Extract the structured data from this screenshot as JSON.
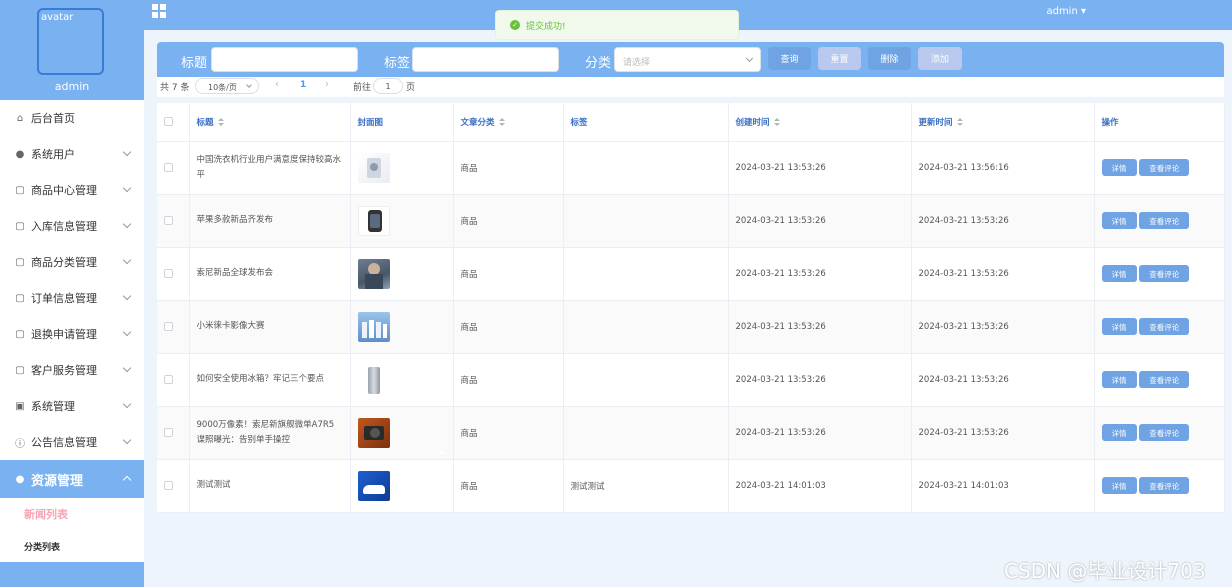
{
  "header": {
    "system_title": "",
    "user_menu": "admin ▾"
  },
  "toast": {
    "message": "提交成功!"
  },
  "sidebar": {
    "avatar_alt": "avatar",
    "username": "admin",
    "items": [
      {
        "label": "后台首页",
        "icon": "home-icon"
      },
      {
        "label": "系统用户",
        "icon": "user-icon"
      },
      {
        "label": "商品中心管理",
        "icon": "folder-icon"
      },
      {
        "label": "入库信息管理",
        "icon": "folder-icon"
      },
      {
        "label": "商品分类管理",
        "icon": "folder-icon"
      },
      {
        "label": "订单信息管理",
        "icon": "folder-icon"
      },
      {
        "label": "退换申请管理",
        "icon": "folder-icon"
      },
      {
        "label": "客户服务管理",
        "icon": "folder-icon"
      },
      {
        "label": "系统管理",
        "icon": "picture-icon"
      },
      {
        "label": "公告信息管理",
        "icon": "info-icon"
      },
      {
        "label": "资源管理",
        "icon": "bulb-icon"
      }
    ],
    "sub_items": [
      {
        "label": "新闻列表"
      },
      {
        "label": "分类列表"
      }
    ]
  },
  "search": {
    "title_label": "标题",
    "tag_label": "标签",
    "category_label": "分类",
    "category_placeholder": "请选择",
    "query_button": "查询",
    "reset_button": "重置",
    "delete_button": "删除",
    "add_button": "添加"
  },
  "pagination": {
    "total": "共 7 条",
    "page_size": "10条/页",
    "current_page": "1",
    "goto_prefix": "前往",
    "goto_value": "1",
    "goto_suffix": "页"
  },
  "table": {
    "headers": {
      "title": "标题",
      "cover": "封面图",
      "category": "文章分类",
      "tag": "标签",
      "created": "创建时间",
      "updated": "更新时间",
      "actions": "操作"
    },
    "detail_button": "详情",
    "comment_button": "查看评论",
    "rows": [
      {
        "title": "中国洗衣机行业用户满意度保持较高水平",
        "category": "商品",
        "tag": "",
        "created": "2024-03-21 13:53:26",
        "updated": "2024-03-21 13:56:16"
      },
      {
        "title": "苹果多款新品齐发布",
        "category": "商品",
        "tag": "",
        "created": "2024-03-21 13:53:26",
        "updated": "2024-03-21 13:53:26"
      },
      {
        "title": "索尼新品全球发布会",
        "category": "商品",
        "tag": "",
        "created": "2024-03-21 13:53:26",
        "updated": "2024-03-21 13:53:26"
      },
      {
        "title": "小米徕卡影像大赛",
        "category": "商品",
        "tag": "",
        "created": "2024-03-21 13:53:26",
        "updated": "2024-03-21 13:53:26"
      },
      {
        "title": "如何安全使用冰箱？牢记三个要点",
        "category": "商品",
        "tag": "",
        "created": "2024-03-21 13:53:26",
        "updated": "2024-03-21 13:53:26"
      },
      {
        "title": "9000万像素！索尼新旗舰微单A7R5谍照曝光：告别单手操控",
        "category": "商品",
        "tag": "",
        "created": "2024-03-21 13:53:26",
        "updated": "2024-03-21 13:53:26"
      },
      {
        "title": "测试测试",
        "category": "商品",
        "tag": "测试测试",
        "created": "2024-03-21 14:01:03",
        "updated": "2024-03-21 14:01:03"
      }
    ]
  },
  "watermark": "CSDN @毕业设计703",
  "colors": {
    "primary": "#7ab2f1",
    "action": "#6fa3e3",
    "success": "#67c23a",
    "active_sub": "#f5a3b5"
  }
}
